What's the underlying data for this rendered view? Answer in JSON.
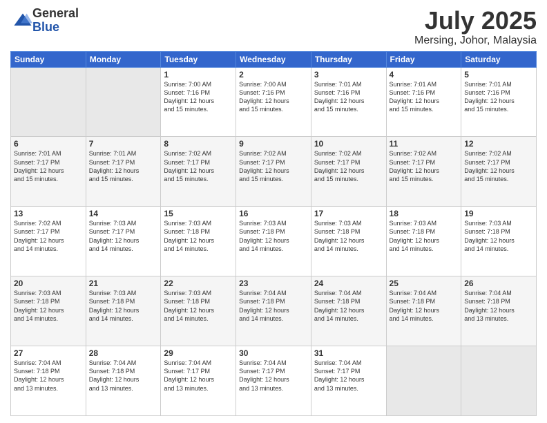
{
  "logo": {
    "general": "General",
    "blue": "Blue"
  },
  "title": "July 2025",
  "location": "Mersing, Johor, Malaysia",
  "days_of_week": [
    "Sunday",
    "Monday",
    "Tuesday",
    "Wednesday",
    "Thursday",
    "Friday",
    "Saturday"
  ],
  "weeks": [
    [
      {
        "day": "",
        "info": ""
      },
      {
        "day": "",
        "info": ""
      },
      {
        "day": "1",
        "info": "Sunrise: 7:00 AM\nSunset: 7:16 PM\nDaylight: 12 hours\nand 15 minutes."
      },
      {
        "day": "2",
        "info": "Sunrise: 7:00 AM\nSunset: 7:16 PM\nDaylight: 12 hours\nand 15 minutes."
      },
      {
        "day": "3",
        "info": "Sunrise: 7:01 AM\nSunset: 7:16 PM\nDaylight: 12 hours\nand 15 minutes."
      },
      {
        "day": "4",
        "info": "Sunrise: 7:01 AM\nSunset: 7:16 PM\nDaylight: 12 hours\nand 15 minutes."
      },
      {
        "day": "5",
        "info": "Sunrise: 7:01 AM\nSunset: 7:16 PM\nDaylight: 12 hours\nand 15 minutes."
      }
    ],
    [
      {
        "day": "6",
        "info": "Sunrise: 7:01 AM\nSunset: 7:17 PM\nDaylight: 12 hours\nand 15 minutes."
      },
      {
        "day": "7",
        "info": "Sunrise: 7:01 AM\nSunset: 7:17 PM\nDaylight: 12 hours\nand 15 minutes."
      },
      {
        "day": "8",
        "info": "Sunrise: 7:02 AM\nSunset: 7:17 PM\nDaylight: 12 hours\nand 15 minutes."
      },
      {
        "day": "9",
        "info": "Sunrise: 7:02 AM\nSunset: 7:17 PM\nDaylight: 12 hours\nand 15 minutes."
      },
      {
        "day": "10",
        "info": "Sunrise: 7:02 AM\nSunset: 7:17 PM\nDaylight: 12 hours\nand 15 minutes."
      },
      {
        "day": "11",
        "info": "Sunrise: 7:02 AM\nSunset: 7:17 PM\nDaylight: 12 hours\nand 15 minutes."
      },
      {
        "day": "12",
        "info": "Sunrise: 7:02 AM\nSunset: 7:17 PM\nDaylight: 12 hours\nand 15 minutes."
      }
    ],
    [
      {
        "day": "13",
        "info": "Sunrise: 7:02 AM\nSunset: 7:17 PM\nDaylight: 12 hours\nand 14 minutes."
      },
      {
        "day": "14",
        "info": "Sunrise: 7:03 AM\nSunset: 7:17 PM\nDaylight: 12 hours\nand 14 minutes."
      },
      {
        "day": "15",
        "info": "Sunrise: 7:03 AM\nSunset: 7:18 PM\nDaylight: 12 hours\nand 14 minutes."
      },
      {
        "day": "16",
        "info": "Sunrise: 7:03 AM\nSunset: 7:18 PM\nDaylight: 12 hours\nand 14 minutes."
      },
      {
        "day": "17",
        "info": "Sunrise: 7:03 AM\nSunset: 7:18 PM\nDaylight: 12 hours\nand 14 minutes."
      },
      {
        "day": "18",
        "info": "Sunrise: 7:03 AM\nSunset: 7:18 PM\nDaylight: 12 hours\nand 14 minutes."
      },
      {
        "day": "19",
        "info": "Sunrise: 7:03 AM\nSunset: 7:18 PM\nDaylight: 12 hours\nand 14 minutes."
      }
    ],
    [
      {
        "day": "20",
        "info": "Sunrise: 7:03 AM\nSunset: 7:18 PM\nDaylight: 12 hours\nand 14 minutes."
      },
      {
        "day": "21",
        "info": "Sunrise: 7:03 AM\nSunset: 7:18 PM\nDaylight: 12 hours\nand 14 minutes."
      },
      {
        "day": "22",
        "info": "Sunrise: 7:03 AM\nSunset: 7:18 PM\nDaylight: 12 hours\nand 14 minutes."
      },
      {
        "day": "23",
        "info": "Sunrise: 7:04 AM\nSunset: 7:18 PM\nDaylight: 12 hours\nand 14 minutes."
      },
      {
        "day": "24",
        "info": "Sunrise: 7:04 AM\nSunset: 7:18 PM\nDaylight: 12 hours\nand 14 minutes."
      },
      {
        "day": "25",
        "info": "Sunrise: 7:04 AM\nSunset: 7:18 PM\nDaylight: 12 hours\nand 14 minutes."
      },
      {
        "day": "26",
        "info": "Sunrise: 7:04 AM\nSunset: 7:18 PM\nDaylight: 12 hours\nand 13 minutes."
      }
    ],
    [
      {
        "day": "27",
        "info": "Sunrise: 7:04 AM\nSunset: 7:18 PM\nDaylight: 12 hours\nand 13 minutes."
      },
      {
        "day": "28",
        "info": "Sunrise: 7:04 AM\nSunset: 7:18 PM\nDaylight: 12 hours\nand 13 minutes."
      },
      {
        "day": "29",
        "info": "Sunrise: 7:04 AM\nSunset: 7:17 PM\nDaylight: 12 hours\nand 13 minutes."
      },
      {
        "day": "30",
        "info": "Sunrise: 7:04 AM\nSunset: 7:17 PM\nDaylight: 12 hours\nand 13 minutes."
      },
      {
        "day": "31",
        "info": "Sunrise: 7:04 AM\nSunset: 7:17 PM\nDaylight: 12 hours\nand 13 minutes."
      },
      {
        "day": "",
        "info": ""
      },
      {
        "day": "",
        "info": ""
      }
    ]
  ]
}
